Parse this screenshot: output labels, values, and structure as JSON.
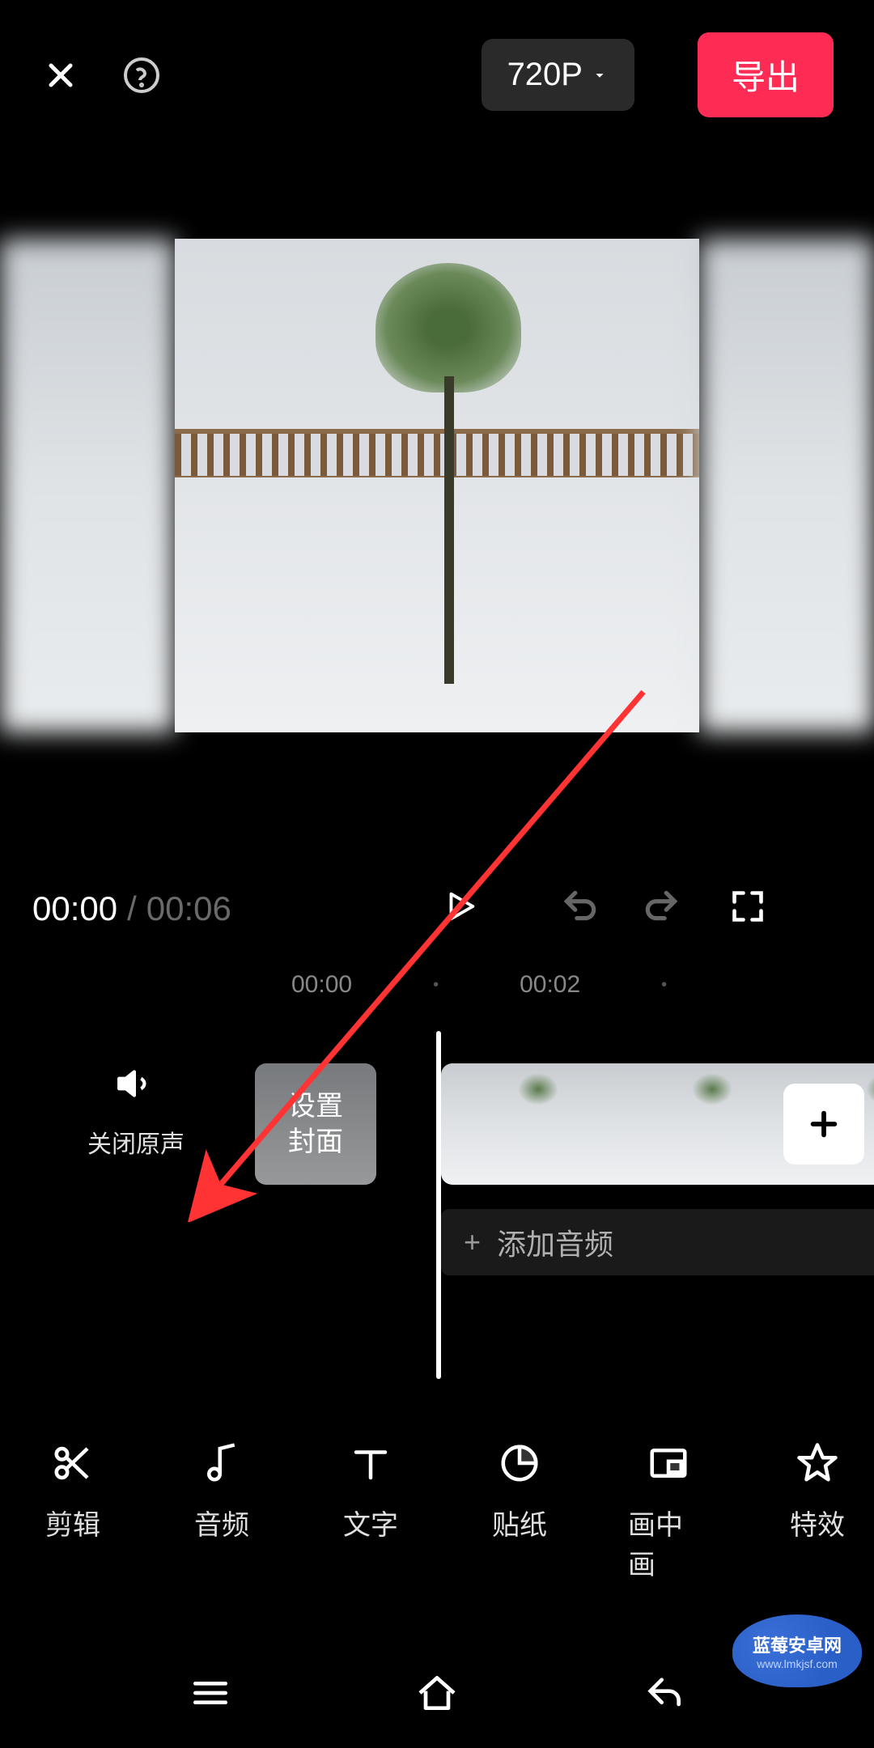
{
  "header": {
    "resolution": "720P",
    "export": "导出"
  },
  "playback": {
    "current": "00:00",
    "sep": "/",
    "total": "00:06"
  },
  "ruler": {
    "t0": "00:00",
    "t1": "00:02"
  },
  "timeline": {
    "mute_label": "关闭原声",
    "cover_label": "设置\n封面",
    "audio_label": "添加音频",
    "audio_plus": "+"
  },
  "tools": {
    "edit": "剪辑",
    "audio": "音频",
    "text": "文字",
    "sticker": "贴纸",
    "pip": "画中画",
    "effect": "特效"
  },
  "watermark": {
    "name": "蓝莓安卓网",
    "url": "www.lmkjsf.com"
  }
}
